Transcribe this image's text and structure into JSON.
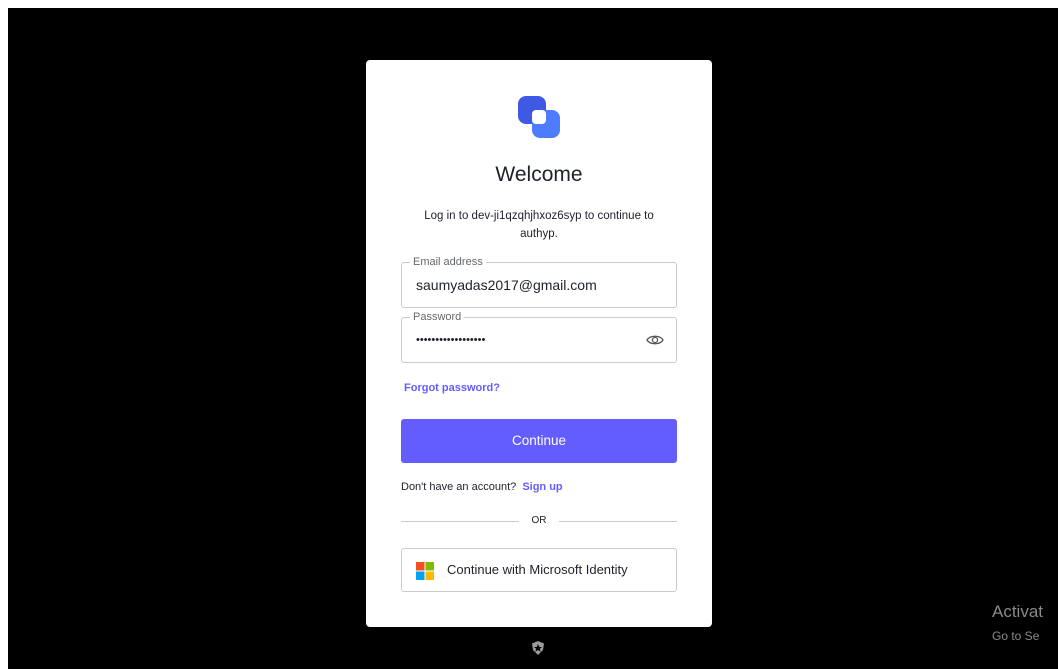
{
  "login": {
    "title": "Welcome",
    "subtitle": "Log in to dev-ji1qzqhjhxoz6syp to continue to authyp.",
    "email": {
      "label": "Email address",
      "value": "saumyadas2017@gmail.com"
    },
    "password": {
      "label": "Password",
      "value": "••••••••••••••••••"
    },
    "forgot_label": "Forgot password?",
    "continue_label": "Continue",
    "signup_prompt": "Don't have an account?",
    "signup_label": "Sign up",
    "divider_label": "OR",
    "microsoft_label": "Continue with Microsoft Identity"
  },
  "icons": {
    "brand": "app-logo-icon",
    "show_password": "eye-icon",
    "microsoft": "microsoft-logo-icon",
    "footer": "shield-badge-icon"
  },
  "overlay": {
    "activate_title": "Activat",
    "activate_sub": "Go to Se"
  },
  "colors": {
    "accent": "#635dff",
    "brand_blue": "#3f59e4",
    "background": "#000000"
  }
}
